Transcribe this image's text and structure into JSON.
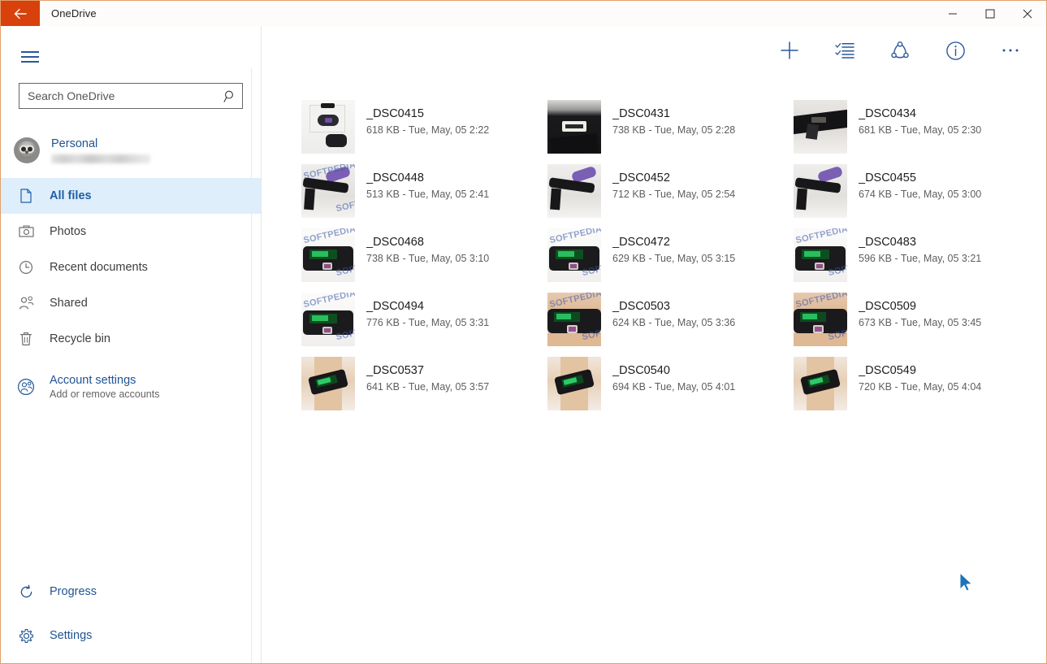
{
  "window": {
    "title": "OneDrive",
    "back_icon": "back-arrow-icon",
    "minimize_label": "—",
    "maximize_label": "☐",
    "close_label": "✕"
  },
  "sidebar": {
    "menu_icon": "hamburger-menu-icon",
    "search": {
      "placeholder": "Search OneDrive",
      "value": "",
      "icon": "search-icon"
    },
    "account": {
      "name": "Personal",
      "email_masked": "",
      "avatar": "owl-avatar"
    },
    "items": [
      {
        "label": "All files",
        "icon": "document-icon",
        "active": true
      },
      {
        "label": "Photos",
        "icon": "camera-icon",
        "active": false
      },
      {
        "label": "Recent documents",
        "icon": "clock-icon",
        "active": false
      },
      {
        "label": "Shared",
        "icon": "people-icon",
        "active": false
      },
      {
        "label": "Recycle bin",
        "icon": "trash-icon",
        "active": false
      }
    ],
    "account_settings": {
      "label": "Account settings",
      "sublabel": "Add or remove accounts",
      "icon": "account-circle-icon"
    },
    "bottom_items": [
      {
        "label": "Progress",
        "icon": "refresh-icon"
      },
      {
        "label": "Settings",
        "icon": "gear-icon"
      }
    ]
  },
  "toolbar": {
    "buttons": [
      {
        "name": "add-button",
        "icon": "plus-icon"
      },
      {
        "name": "select-button",
        "icon": "checklist-icon"
      },
      {
        "name": "share-button",
        "icon": "share-icon"
      },
      {
        "name": "info-button",
        "icon": "info-icon"
      },
      {
        "name": "more-options-button",
        "icon": "ellipsis-icon"
      }
    ]
  },
  "files": [
    {
      "name": "_DSC0415",
      "size": "618 KB",
      "date": "Tue, May, 05 2:22",
      "sub": "618 KB - Tue, May, 05 2:22",
      "watermark": false
    },
    {
      "name": "_DSC0431",
      "size": "738 KB",
      "date": "Tue, May, 05 2:28",
      "sub": "738 KB - Tue, May, 05 2:28",
      "watermark": false
    },
    {
      "name": "_DSC0434",
      "size": "681 KB",
      "date": "Tue, May, 05 2:30",
      "sub": "681 KB - Tue, May, 05 2:30",
      "watermark": false
    },
    {
      "name": "_DSC0448",
      "size": "513 KB",
      "date": "Tue, May, 05 2:41",
      "sub": "513 KB - Tue, May, 05 2:41",
      "watermark": true
    },
    {
      "name": "_DSC0452",
      "size": "712 KB",
      "date": "Tue, May, 05 2:54",
      "sub": "712 KB - Tue, May, 05 2:54",
      "watermark": false
    },
    {
      "name": "_DSC0455",
      "size": "674 KB",
      "date": "Tue, May, 05 3:00",
      "sub": "674 KB - Tue, May, 05 3:00",
      "watermark": false
    },
    {
      "name": "_DSC0468",
      "size": "738 KB",
      "date": "Tue, May, 05 3:10",
      "sub": "738 KB - Tue, May, 05 3:10",
      "watermark": true
    },
    {
      "name": "_DSC0472",
      "size": "629 KB",
      "date": "Tue, May, 05 3:15",
      "sub": "629 KB - Tue, May, 05 3:15",
      "watermark": true
    },
    {
      "name": "_DSC0483",
      "size": "596 KB",
      "date": "Tue, May, 05 3:21",
      "sub": "596 KB - Tue, May, 05 3:21",
      "watermark": true
    },
    {
      "name": "_DSC0494",
      "size": "776 KB",
      "date": "Tue, May, 05 3:31",
      "sub": "776 KB - Tue, May, 05 3:31",
      "watermark": true
    },
    {
      "name": "_DSC0503",
      "size": "624 KB",
      "date": "Tue, May, 05 3:36",
      "sub": "624 KB - Tue, May, 05 3:36",
      "watermark": true
    },
    {
      "name": "_DSC0509",
      "size": "673 KB",
      "date": "Tue, May, 05 3:45",
      "sub": "673 KB - Tue, May, 05 3:45",
      "watermark": true
    },
    {
      "name": "_DSC0537",
      "size": "641 KB",
      "date": "Tue, May, 05 3:57",
      "sub": "641 KB - Tue, May, 05 3:57",
      "watermark": false
    },
    {
      "name": "_DSC0540",
      "size": "694 KB",
      "date": "Tue, May, 05 4:01",
      "sub": "694 KB - Tue, May, 05 4:01",
      "watermark": false
    },
    {
      "name": "_DSC0549",
      "size": "720 KB",
      "date": "Tue, May, 05 4:04",
      "sub": "720 KB - Tue, May, 05 4:04",
      "watermark": false
    }
  ],
  "watermark_text": "SOFTPEDIA",
  "cursor": {
    "icon": "mouse-pointer-icon",
    "color": "#1f72b8"
  },
  "colors": {
    "accent_orange": "#d8400c",
    "link_blue": "#205493",
    "active_bg": "#dfeefb",
    "icon_blue": "#2b579a"
  }
}
